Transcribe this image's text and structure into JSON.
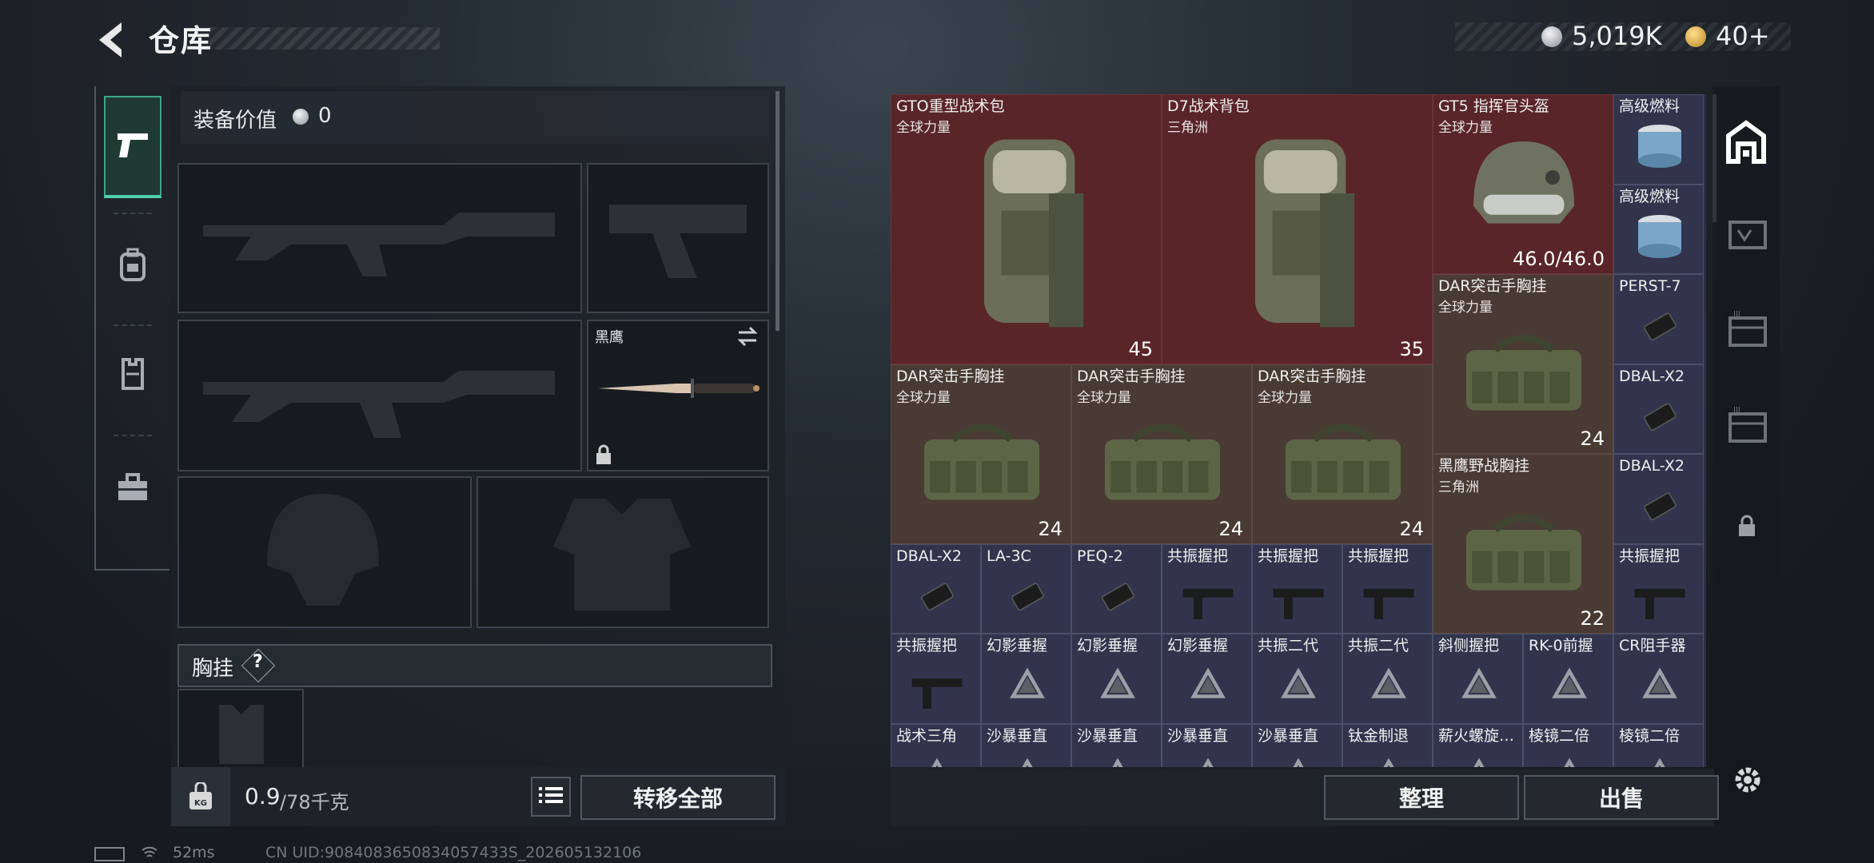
{
  "header": {
    "title": "仓库",
    "currency_value": "5,019K",
    "token_value": "40+"
  },
  "left_nav": {
    "items": [
      "pistol-icon",
      "backpack-icon",
      "vest-icon",
      "toolbox-icon"
    ]
  },
  "equipment": {
    "value_label": "装备价值",
    "value": "0",
    "knife_name": "黑鹰",
    "chest_rig_label": "胸挂",
    "help_mark": "?"
  },
  "bottom_bar": {
    "weight_value": "0.9",
    "weight_max": "/78千克",
    "transfer_all": "转移全部"
  },
  "inventory": {
    "items": [
      {
        "name": "GTO重型战术包",
        "sub": "全球力量",
        "count": "45",
        "color": "#5a2528",
        "kind": "backpack"
      },
      {
        "name": "D7战术背包",
        "sub": "三角洲",
        "count": "35",
        "color": "#5a2528",
        "kind": "backpack"
      },
      {
        "name": "GT5 指挥官头盔",
        "sub": "全球力量",
        "count": "46.0/46.0",
        "color": "#5a2528",
        "kind": "helmet"
      },
      {
        "name": "高级燃料",
        "sub": "",
        "count": "",
        "color": "#31344c",
        "kind": "can"
      },
      {
        "name": "高级燃料",
        "sub": "",
        "count": "",
        "color": "#31344c",
        "kind": "can"
      },
      {
        "name": "DAR突击手胸挂",
        "sub": "全球力量",
        "count": "24",
        "color": "#4a3a34",
        "kind": "rig"
      },
      {
        "name": "PERST-7",
        "sub": "",
        "count": "",
        "color": "#31344c",
        "kind": "device"
      },
      {
        "name": "DBAL-X2",
        "sub": "",
        "count": "",
        "color": "#31344c",
        "kind": "device"
      },
      {
        "name": "DAR突击手胸挂",
        "sub": "全球力量",
        "count": "24",
        "color": "#4a3a34",
        "kind": "rig"
      },
      {
        "name": "DAR突击手胸挂",
        "sub": "全球力量",
        "count": "24",
        "color": "#4a3a34",
        "kind": "rig"
      },
      {
        "name": "DAR突击手胸挂",
        "sub": "全球力量",
        "count": "24",
        "color": "#4a3a34",
        "kind": "rig"
      },
      {
        "name": "黑鹰野战胸挂",
        "sub": "三角洲",
        "count": "22",
        "color": "#4a3a34",
        "kind": "rig"
      },
      {
        "name": "DBAL-X2",
        "sub": "",
        "count": "",
        "color": "#31344c",
        "kind": "device"
      },
      {
        "name": "DBAL-X2",
        "sub": "",
        "count": "",
        "color": "#31344c",
        "kind": "device"
      },
      {
        "name": "LA-3C",
        "sub": "",
        "count": "",
        "color": "#31344c",
        "kind": "device"
      },
      {
        "name": "PEQ-2",
        "sub": "",
        "count": "",
        "color": "#31344c",
        "kind": "device"
      },
      {
        "name": "共振握把",
        "sub": "",
        "count": "",
        "color": "#31344c",
        "kind": "grip"
      },
      {
        "name": "共振握把",
        "sub": "",
        "count": "",
        "color": "#31344c",
        "kind": "grip"
      },
      {
        "name": "共振握把",
        "sub": "",
        "count": "",
        "color": "#31344c",
        "kind": "grip"
      },
      {
        "name": "共振握把",
        "sub": "",
        "count": "",
        "color": "#31344c",
        "kind": "grip"
      },
      {
        "name": "共振握把",
        "sub": "",
        "count": "",
        "color": "#31344c",
        "kind": "grip"
      },
      {
        "name": "幻影垂握",
        "sub": "",
        "count": "",
        "color": "#31344c",
        "kind": "unknown"
      },
      {
        "name": "幻影垂握",
        "sub": "",
        "count": "",
        "color": "#31344c",
        "kind": "unknown"
      },
      {
        "name": "幻影垂握",
        "sub": "",
        "count": "",
        "color": "#31344c",
        "kind": "unknown"
      },
      {
        "name": "共振二代",
        "sub": "",
        "count": "",
        "color": "#31344c",
        "kind": "unknown"
      },
      {
        "name": "共振二代",
        "sub": "",
        "count": "",
        "color": "#31344c",
        "kind": "unknown"
      },
      {
        "name": "斜侧握把",
        "sub": "",
        "count": "",
        "color": "#31344c",
        "kind": "unknown"
      },
      {
        "name": "RK-0前握",
        "sub": "",
        "count": "",
        "color": "#31344c",
        "kind": "unknown"
      },
      {
        "name": "CR阻手器",
        "sub": "",
        "count": "",
        "color": "#31344c",
        "kind": "unknown"
      },
      {
        "name": "战术三角",
        "sub": "",
        "count": "",
        "color": "#31344c",
        "kind": "unknown"
      },
      {
        "name": "沙暴垂直",
        "sub": "",
        "count": "",
        "color": "#31344c",
        "kind": "unknown"
      },
      {
        "name": "沙暴垂直",
        "sub": "",
        "count": "",
        "color": "#31344c",
        "kind": "unknown"
      },
      {
        "name": "沙暴垂直",
        "sub": "",
        "count": "",
        "color": "#31344c",
        "kind": "unknown"
      },
      {
        "name": "沙暴垂直",
        "sub": "",
        "count": "",
        "color": "#31344c",
        "kind": "unknown"
      },
      {
        "name": "钛金制退",
        "sub": "",
        "count": "",
        "color": "#31344c",
        "kind": "unknown"
      },
      {
        "name": "薪火螺旋…",
        "sub": "",
        "count": "",
        "color": "#31344c",
        "kind": "unknown"
      },
      {
        "name": "棱镜二倍",
        "sub": "",
        "count": "",
        "color": "#31344c",
        "kind": "unknown"
      },
      {
        "name": "棱镜二倍",
        "sub": "",
        "count": "",
        "color": "#31344c",
        "kind": "unknown"
      }
    ]
  },
  "actions": {
    "sort": "整理",
    "sell": "出售"
  },
  "status": {
    "latency": "52ms",
    "uid": "CN UID:9084083650834057433S_202605132106"
  }
}
